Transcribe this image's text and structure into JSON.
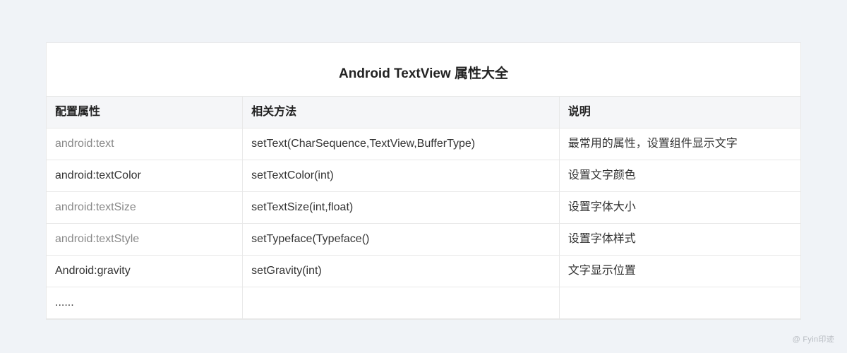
{
  "table": {
    "title": "Android TextView 属性大全",
    "headers": [
      "配置属性",
      "相关方法",
      "说明"
    ],
    "rows": [
      {
        "attr": "android:text",
        "method": "setText(CharSequence,TextView,BufferType)",
        "desc": "最常用的属性，设置组件显示文字",
        "muted": true
      },
      {
        "attr": "android:textColor",
        "method": "setTextColor(int)",
        "desc": "设置文字颜色",
        "muted": false
      },
      {
        "attr": "android:textSize",
        "method": "setTextSize(int,float)",
        "desc": "设置字体大小",
        "muted": true
      },
      {
        "attr": "android:textStyle",
        "method": "setTypeface(Typeface()",
        "desc": "设置字体样式",
        "muted": true
      },
      {
        "attr": "Android:gravity",
        "method": "setGravity(int)",
        "desc": "文字显示位置",
        "muted": false
      },
      {
        "attr": "......",
        "method": "",
        "desc": "",
        "muted": false
      }
    ]
  },
  "watermark": "@ Fyin印迹"
}
